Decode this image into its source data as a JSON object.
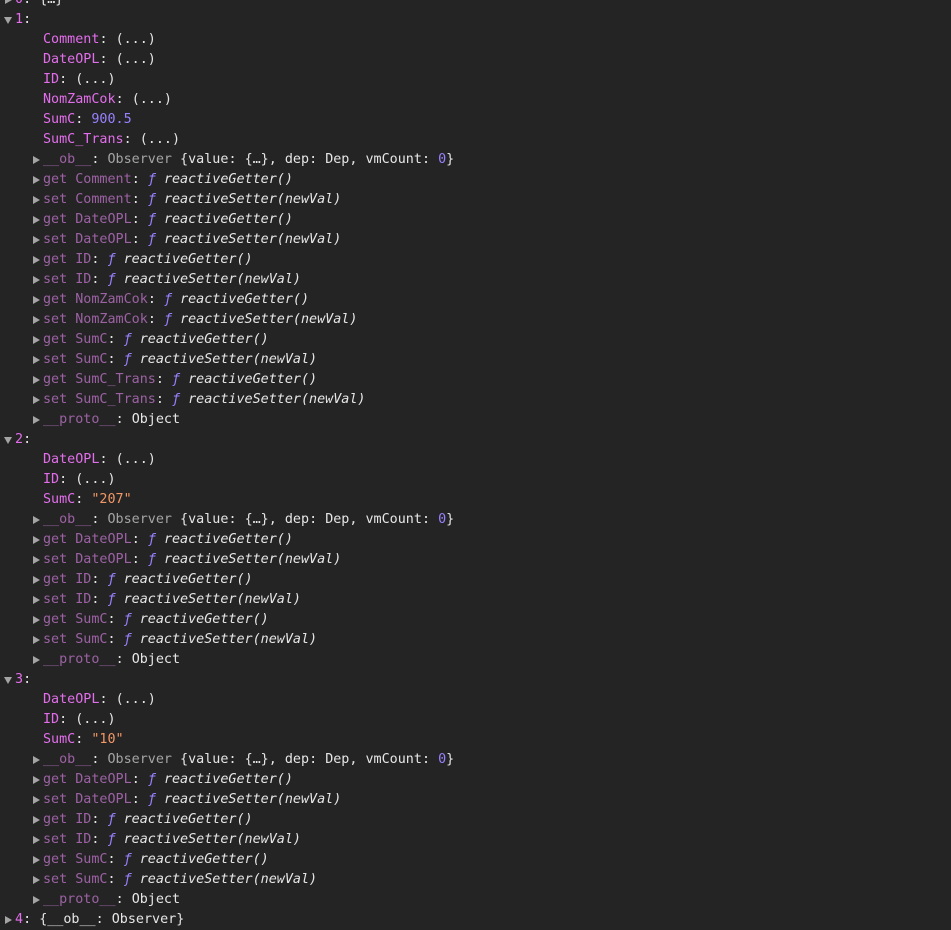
{
  "top_partial": {
    "index": "0",
    "preview": "{…}"
  },
  "entries": [
    {
      "index": "1",
      "fields": [
        {
          "key": "Comment",
          "value": "(...)",
          "type": "lazy"
        },
        {
          "key": "DateOPL",
          "value": "(...)",
          "type": "lazy"
        },
        {
          "key": "ID",
          "value": "(...)",
          "type": "lazy"
        },
        {
          "key": "NomZamCok",
          "value": "(...)",
          "type": "lazy"
        },
        {
          "key": "SumC",
          "value": "900.5",
          "type": "number"
        },
        {
          "key": "SumC_Trans",
          "value": "(...)",
          "type": "lazy"
        }
      ],
      "ob": {
        "key": "__ob__",
        "class": "Observer",
        "value_label": "value",
        "value_preview": "{…}",
        "dep_label": "dep",
        "dep_value": "Dep",
        "vmcount_label": "vmCount",
        "vmcount": "0"
      },
      "accessors": [
        {
          "kind": "get",
          "name": "Comment",
          "fn": "reactiveGetter()"
        },
        {
          "kind": "set",
          "name": "Comment",
          "fn": "reactiveSetter(newVal)"
        },
        {
          "kind": "get",
          "name": "DateOPL",
          "fn": "reactiveGetter()"
        },
        {
          "kind": "set",
          "name": "DateOPL",
          "fn": "reactiveSetter(newVal)"
        },
        {
          "kind": "get",
          "name": "ID",
          "fn": "reactiveGetter()"
        },
        {
          "kind": "set",
          "name": "ID",
          "fn": "reactiveSetter(newVal)"
        },
        {
          "kind": "get",
          "name": "NomZamCok",
          "fn": "reactiveGetter()"
        },
        {
          "kind": "set",
          "name": "NomZamCok",
          "fn": "reactiveSetter(newVal)"
        },
        {
          "kind": "get",
          "name": "SumC",
          "fn": "reactiveGetter()"
        },
        {
          "kind": "set",
          "name": "SumC",
          "fn": "reactiveSetter(newVal)"
        },
        {
          "kind": "get",
          "name": "SumC_Trans",
          "fn": "reactiveGetter()"
        },
        {
          "kind": "set",
          "name": "SumC_Trans",
          "fn": "reactiveSetter(newVal)"
        }
      ],
      "proto": {
        "key": "__proto__",
        "value": "Object"
      }
    },
    {
      "index": "2",
      "fields": [
        {
          "key": "DateOPL",
          "value": "(...)",
          "type": "lazy"
        },
        {
          "key": "ID",
          "value": "(...)",
          "type": "lazy"
        },
        {
          "key": "SumC",
          "value": "\"207\"",
          "type": "string"
        }
      ],
      "ob": {
        "key": "__ob__",
        "class": "Observer",
        "value_label": "value",
        "value_preview": "{…}",
        "dep_label": "dep",
        "dep_value": "Dep",
        "vmcount_label": "vmCount",
        "vmcount": "0"
      },
      "accessors": [
        {
          "kind": "get",
          "name": "DateOPL",
          "fn": "reactiveGetter()"
        },
        {
          "kind": "set",
          "name": "DateOPL",
          "fn": "reactiveSetter(newVal)"
        },
        {
          "kind": "get",
          "name": "ID",
          "fn": "reactiveGetter()"
        },
        {
          "kind": "set",
          "name": "ID",
          "fn": "reactiveSetter(newVal)"
        },
        {
          "kind": "get",
          "name": "SumC",
          "fn": "reactiveGetter()"
        },
        {
          "kind": "set",
          "name": "SumC",
          "fn": "reactiveSetter(newVal)"
        }
      ],
      "proto": {
        "key": "__proto__",
        "value": "Object"
      }
    },
    {
      "index": "3",
      "fields": [
        {
          "key": "DateOPL",
          "value": "(...)",
          "type": "lazy"
        },
        {
          "key": "ID",
          "value": "(...)",
          "type": "lazy"
        },
        {
          "key": "SumC",
          "value": "\"10\"",
          "type": "string"
        }
      ],
      "ob": {
        "key": "__ob__",
        "class": "Observer",
        "value_label": "value",
        "value_preview": "{…}",
        "dep_label": "dep",
        "dep_value": "Dep",
        "vmcount_label": "vmCount",
        "vmcount": "0"
      },
      "accessors": [
        {
          "kind": "get",
          "name": "DateOPL",
          "fn": "reactiveGetter()"
        },
        {
          "kind": "set",
          "name": "DateOPL",
          "fn": "reactiveSetter(newVal)"
        },
        {
          "kind": "get",
          "name": "ID",
          "fn": "reactiveGetter()"
        },
        {
          "kind": "set",
          "name": "ID",
          "fn": "reactiveSetter(newVal)"
        },
        {
          "kind": "get",
          "name": "SumC",
          "fn": "reactiveGetter()"
        },
        {
          "kind": "set",
          "name": "SumC",
          "fn": "reactiveSetter(newVal)"
        }
      ],
      "proto": {
        "key": "__proto__",
        "value": "Object"
      }
    }
  ],
  "bottom_partial": {
    "index": "4",
    "preview": "{__ob__: Observer}"
  },
  "icons": {
    "expanded": "triangle-down-icon",
    "collapsed": "triangle-right-icon"
  },
  "fn_symbol": "ƒ",
  "colors": {
    "background": "#242424",
    "key": "#e36eec",
    "key_dim": "#9c62a4",
    "gray": "#a4a4a4",
    "number": "#9980ff",
    "string": "#f29766",
    "text": "#e6e6e6"
  }
}
